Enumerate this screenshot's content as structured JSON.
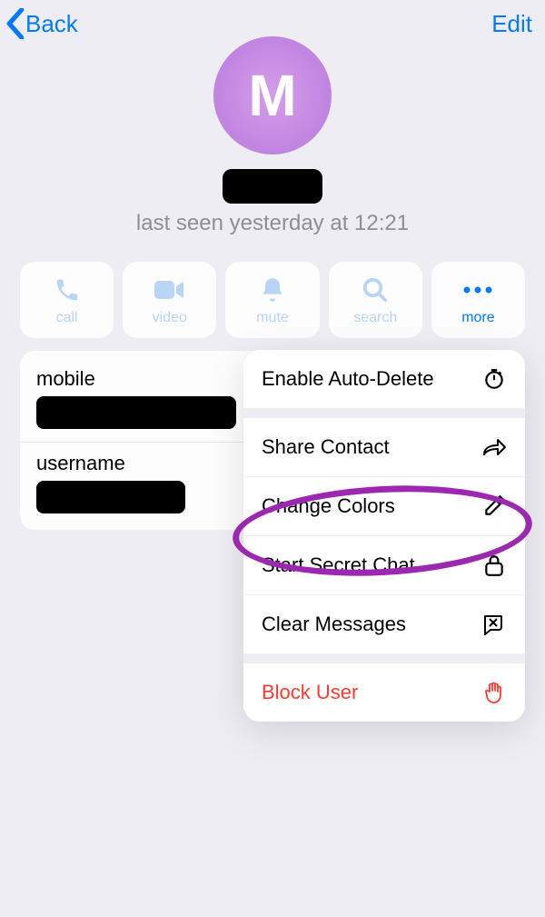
{
  "nav": {
    "back": "Back",
    "edit": "Edit"
  },
  "profile": {
    "avatar_initial": "M",
    "status": "last seen yesterday at 12:21"
  },
  "actions": {
    "call": "call",
    "video": "video",
    "mute": "mute",
    "search": "search",
    "more": "more"
  },
  "info": {
    "mobile_label": "mobile",
    "username_label": "username"
  },
  "menu": {
    "auto_delete": "Enable Auto-Delete",
    "share": "Share Contact",
    "colors": "Change Colors",
    "secret": "Start Secret Chat",
    "clear": "Clear Messages",
    "block": "Block User"
  },
  "annotation": {
    "highlight_target": "start-secret-chat"
  }
}
